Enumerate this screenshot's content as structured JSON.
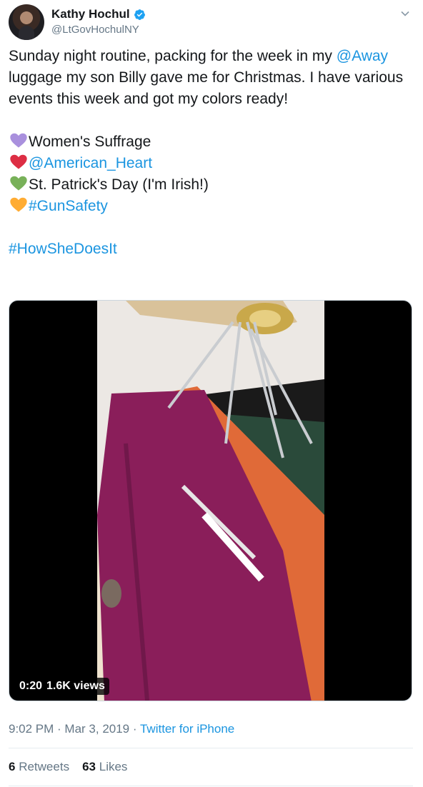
{
  "author": {
    "display_name": "Kathy Hochul",
    "handle": "@LtGovHochulNY"
  },
  "tweet": {
    "line1_pre": "Sunday night routine, packing for the week in my ",
    "mention_away": "@Away",
    "line1_post": " luggage my son Billy gave me for Christmas. I have various events this week and got my colors ready!",
    "items": [
      {
        "heart": "purple-heart",
        "color": "#a990dd",
        "text": "Women's Suffrage",
        "is_link": false
      },
      {
        "heart": "red-heart",
        "color": "#dd2e44",
        "text": "@American_Heart",
        "is_link": true
      },
      {
        "heart": "green-heart",
        "color": "#78b159",
        "text": "St. Patrick's Day (I'm Irish!)",
        "is_link": false
      },
      {
        "heart": "orange-heart",
        "color": "#f4900c",
        "text": "#GunSafety",
        "is_link": true
      }
    ],
    "hashtag": "#HowSheDoesIt"
  },
  "video": {
    "duration": "0:20",
    "views": "1.6K views"
  },
  "meta": {
    "time": "9:02 PM",
    "sep1": " · ",
    "date": "Mar 3, 2019",
    "sep2": " · ",
    "source": "Twitter for iPhone"
  },
  "stats": {
    "retweets_count": "6",
    "retweets_label": "Retweets",
    "likes_count": "63",
    "likes_label": "Likes"
  },
  "colors": {
    "link": "#1b95e0",
    "secondary_text": "#657786",
    "verified": "#1da1f2"
  }
}
